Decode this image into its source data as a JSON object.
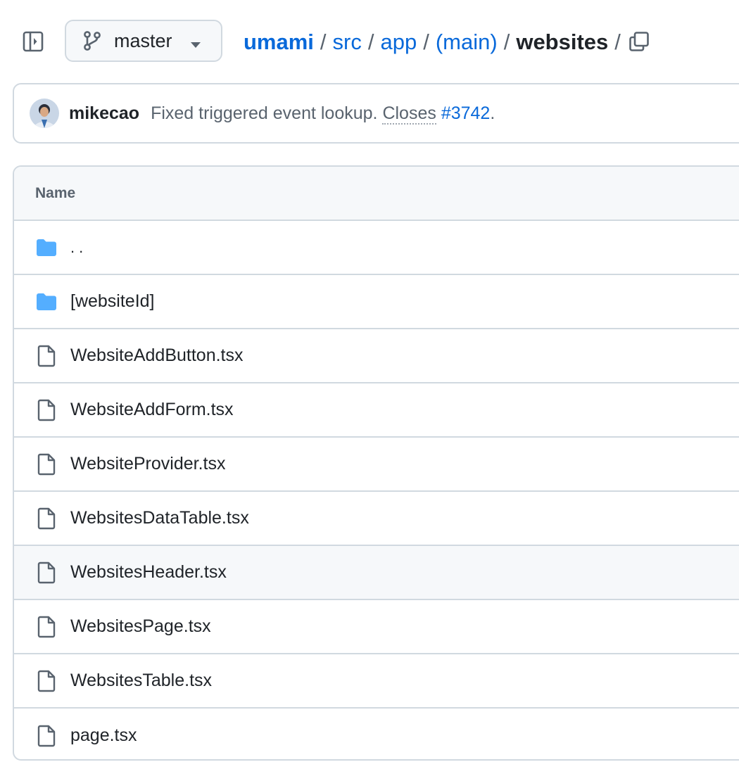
{
  "header": {
    "branch": "master",
    "breadcrumb": {
      "repo": "umami",
      "segments": [
        "src",
        "app",
        "(main)"
      ],
      "current": "websites",
      "trailing_sep": "/"
    },
    "sep": "/"
  },
  "commit": {
    "author": "mikecao",
    "message": "Fixed triggered event lookup.",
    "closes_label": "Closes",
    "issue": "#3742",
    "end_punct": "."
  },
  "table": {
    "column_name": "Name",
    "rows": [
      {
        "name": "..",
        "type": "folder"
      },
      {
        "name": "[websiteId]",
        "type": "folder"
      },
      {
        "name": "WebsiteAddButton.tsx",
        "type": "file"
      },
      {
        "name": "WebsiteAddForm.tsx",
        "type": "file"
      },
      {
        "name": "WebsiteProvider.tsx",
        "type": "file"
      },
      {
        "name": "WebsitesDataTable.tsx",
        "type": "file"
      },
      {
        "name": "WebsitesHeader.tsx",
        "type": "file",
        "hovered": true
      },
      {
        "name": "WebsitesPage.tsx",
        "type": "file"
      },
      {
        "name": "WebsitesTable.tsx",
        "type": "file"
      },
      {
        "name": "page.tsx",
        "type": "file"
      }
    ]
  },
  "colors": {
    "link": "#0969da",
    "folder": "#54aeff",
    "border": "#d1d9e0",
    "muted": "#59636e"
  },
  "icons": {
    "sidebar_toggle": "sidebar-expand-icon",
    "branch": "git-branch-icon",
    "caret": "triangle-down-icon",
    "copy": "copy-icon",
    "folder": "folder-icon",
    "file": "file-icon"
  }
}
